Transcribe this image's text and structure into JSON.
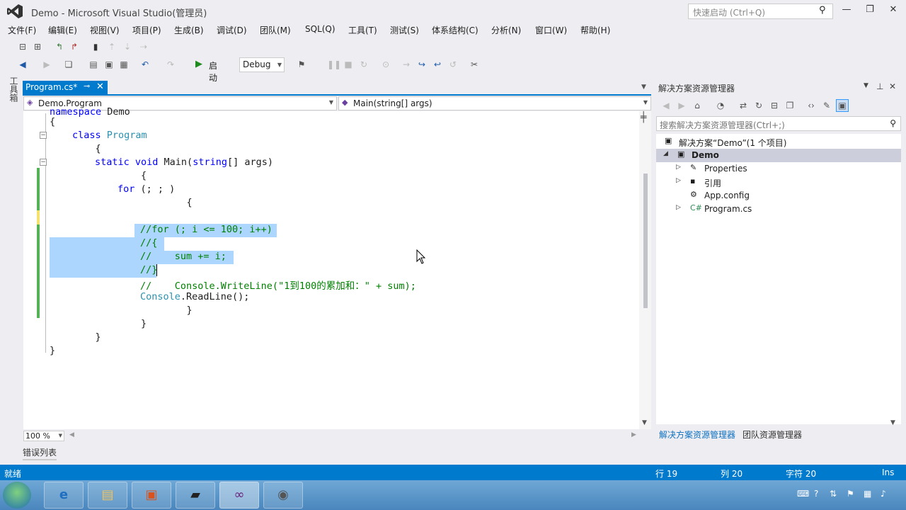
{
  "window": {
    "title": "Demo - Microsoft Visual Studio(管理员)",
    "quick_launch_placeholder": "快速启动 (Ctrl+Q)",
    "minimize": "—",
    "maximize": "❐",
    "close": "✕"
  },
  "menu": [
    "文件(F)",
    "编辑(E)",
    "视图(V)",
    "项目(P)",
    "生成(B)",
    "调试(D)",
    "团队(M)",
    "SQL(Q)",
    "工具(T)",
    "测试(S)",
    "体系结构(C)",
    "分析(N)",
    "窗口(W)",
    "帮助(H)"
  ],
  "toolbar": {
    "start_label": "启动",
    "config_value": "Debug"
  },
  "toolbox_label": "工具箱",
  "editor": {
    "tab_label": "Program.cs*",
    "nav_left": "Demo.Program",
    "nav_right": "Main(string[] args)",
    "zoom": "100 %",
    "lines": [
      "namespace Demo",
      "{",
      "    class Program",
      "    {",
      "        static void Main(string[] args)",
      "        {",
      "            for (; ; )",
      "            {",
      "",
      "                //for (; i <= 100; i++)",
      "                //{",
      "                //    sum += i;",
      "                //}",
      "                //    Console.WriteLine(\"1到100的累加和：\" + sum);",
      "                Console.ReadLine();",
      "            }",
      "        }",
      "    }",
      "}"
    ]
  },
  "solution_explorer": {
    "title": "解决方案资源管理器",
    "search_placeholder": "搜索解决方案资源管理器(Ctrl+;)",
    "solution_label": "解决方案“Demo”(1 个项目)",
    "project_label": "Demo",
    "items": [
      "Properties",
      "引用",
      "App.config",
      "Program.cs"
    ],
    "tab_active": "解决方案资源管理器",
    "tab_other": "团队资源管理器"
  },
  "error_list_tab": "错误列表",
  "status": {
    "ready": "就绪",
    "line": "行 19",
    "col": "列 20",
    "char": "字符 20",
    "mode": "Ins"
  },
  "colors": {
    "accent": "#007acc",
    "keyword": "#0000ff",
    "type": "#2b91af",
    "comment": "#008000",
    "selection": "#add6ff"
  }
}
